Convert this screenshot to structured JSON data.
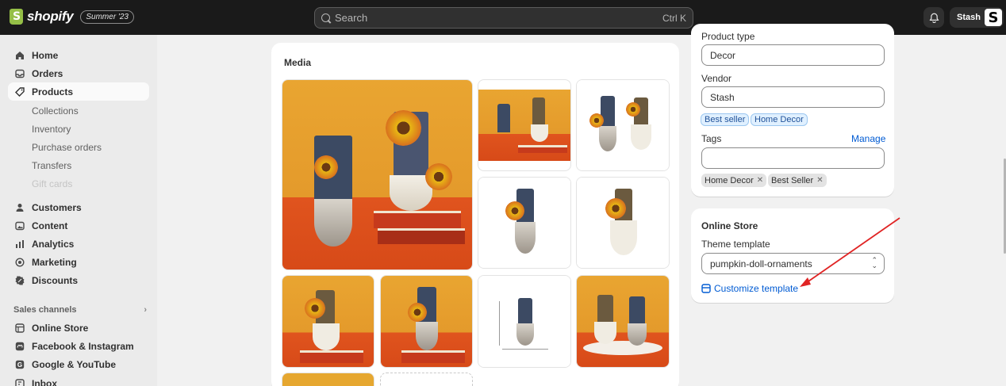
{
  "topbar": {
    "brand": "shopify",
    "edition": "Summer '23",
    "search_placeholder": "Search",
    "search_shortcut": "Ctrl K",
    "store_name": "Stash",
    "store_avatar": "S"
  },
  "sidebar": {
    "items": [
      {
        "label": "Home",
        "icon": "home-icon"
      },
      {
        "label": "Orders",
        "icon": "inbox-tray-icon"
      },
      {
        "label": "Products",
        "icon": "tag-icon"
      },
      {
        "label": "Collections"
      },
      {
        "label": "Inventory"
      },
      {
        "label": "Purchase orders"
      },
      {
        "label": "Transfers"
      },
      {
        "label": "Gift cards"
      },
      {
        "label": "Customers",
        "icon": "person-icon"
      },
      {
        "label": "Content",
        "icon": "image-icon"
      },
      {
        "label": "Analytics",
        "icon": "bar-chart-icon"
      },
      {
        "label": "Marketing",
        "icon": "target-icon"
      },
      {
        "label": "Discounts",
        "icon": "discount-icon"
      }
    ],
    "sales_channels_label": "Sales channels",
    "channels": [
      {
        "label": "Online Store",
        "icon": "store-icon"
      },
      {
        "label": "Facebook & Instagram",
        "icon": "meta-icon"
      },
      {
        "label": "Google & YouTube",
        "icon": "google-icon"
      },
      {
        "label": "Inbox",
        "icon": "inbox-icon"
      }
    ]
  },
  "media": {
    "title": "Media"
  },
  "organization": {
    "product_type_label": "Product type",
    "product_type_value": "Decor",
    "vendor_label": "Vendor",
    "vendor_value": "Stash",
    "suggested_tags": [
      "Best seller",
      "Home Decor"
    ],
    "tags_label": "Tags",
    "manage_label": "Manage",
    "tags": [
      "Home Decor",
      "Best Seller"
    ]
  },
  "online_store": {
    "title": "Online Store",
    "theme_template_label": "Theme template",
    "theme_template_value": "pumpkin-doll-ornaments",
    "customize_label": "Customize template"
  },
  "colors": {
    "accent_link": "#005bd3",
    "annotation_arrow": "#e02424",
    "topbar": "#1a1a1a"
  }
}
